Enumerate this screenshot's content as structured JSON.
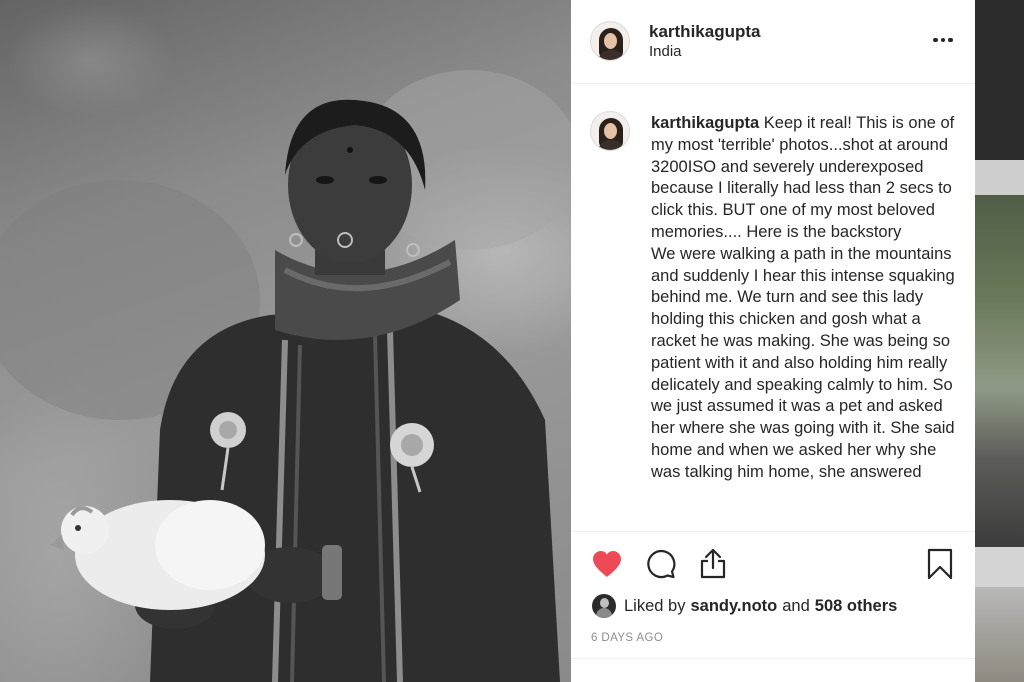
{
  "post": {
    "username": "karthikagupta",
    "location": "India",
    "caption": "Keep it real! This is one of my most 'terrible' photos...shot at around 3200ISO and severely underexposed because I literally had less than 2 secs to click this. BUT one of my most beloved memories.... Here is the backstory\nWe were walking a path in the mountains and suddenly I hear this intense squaking behind me. We turn and see this lady holding this chicken and gosh what a racket he was making. She was being so patient with it and also holding him really delicately and speaking calmly to him. So we just assumed it was a pet and asked her where she was going with it. She said home and when we asked her why she was talking him home, she answered",
    "likes": {
      "prefix": "Liked by",
      "liker": "sandy.noto",
      "joiner": "and",
      "others": "508 others"
    },
    "timestamp": "6 DAYS AGO"
  },
  "icons": {
    "more": "more-horizontal-icon",
    "like": "heart-icon",
    "comment": "comment-bubble-icon",
    "share": "share-upload-icon",
    "save": "bookmark-icon"
  },
  "colors": {
    "liked_heart": "#ed4956",
    "text": "#262626",
    "muted": "#8e8e8e",
    "divider": "#efefef"
  }
}
